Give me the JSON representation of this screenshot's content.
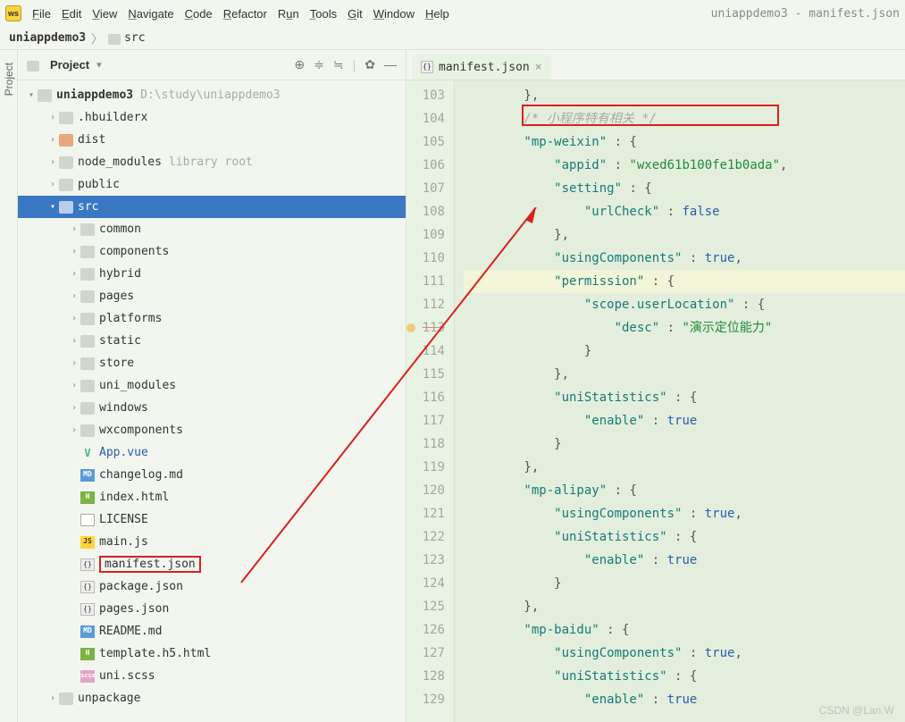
{
  "titlebar": {
    "right": "uniappdemo3 - manifest.json"
  },
  "menu": [
    "File",
    "Edit",
    "View",
    "Navigate",
    "Code",
    "Refactor",
    "Run",
    "Tools",
    "Git",
    "Window",
    "Help"
  ],
  "breadcrumb": {
    "root": "uniappdemo3",
    "path": "src"
  },
  "sidetab": "Project",
  "panel": {
    "title": "Project"
  },
  "tree": {
    "root_name": "uniappdemo3",
    "root_path": "D:\\study\\uniappdemo3",
    "items": [
      {
        "name": ".hbuilderx",
        "type": "folder"
      },
      {
        "name": "dist",
        "type": "folder-dist"
      },
      {
        "name": "node_modules",
        "type": "folder",
        "hint": "library root"
      },
      {
        "name": "public",
        "type": "folder"
      },
      {
        "name": "src",
        "type": "folder",
        "selected": true,
        "expanded": true
      },
      {
        "name": "common",
        "type": "folder",
        "depth": 2,
        "exp": true
      },
      {
        "name": "components",
        "type": "folder",
        "depth": 2,
        "exp": true
      },
      {
        "name": "hybrid",
        "type": "folder",
        "depth": 2,
        "exp": true
      },
      {
        "name": "pages",
        "type": "folder",
        "depth": 2,
        "exp": true
      },
      {
        "name": "platforms",
        "type": "folder",
        "depth": 2,
        "exp": true
      },
      {
        "name": "static",
        "type": "folder",
        "depth": 2,
        "exp": true
      },
      {
        "name": "store",
        "type": "folder",
        "depth": 2,
        "exp": true
      },
      {
        "name": "uni_modules",
        "type": "folder",
        "depth": 2,
        "exp": true
      },
      {
        "name": "windows",
        "type": "folder",
        "depth": 2,
        "exp": true
      },
      {
        "name": "wxcomponents",
        "type": "folder",
        "depth": 2,
        "exp": true
      },
      {
        "name": "App.vue",
        "type": "vue",
        "depth": 2,
        "blue": true
      },
      {
        "name": "changelog.md",
        "type": "md",
        "depth": 2
      },
      {
        "name": "index.html",
        "type": "html",
        "depth": 2
      },
      {
        "name": "LICENSE",
        "type": "file",
        "depth": 2
      },
      {
        "name": "main.js",
        "type": "js",
        "depth": 2
      },
      {
        "name": "manifest.json",
        "type": "json",
        "depth": 2,
        "boxed": true
      },
      {
        "name": "package.json",
        "type": "json",
        "depth": 2
      },
      {
        "name": "pages.json",
        "type": "json",
        "depth": 2
      },
      {
        "name": "README.md",
        "type": "md",
        "depth": 2
      },
      {
        "name": "template.h5.html",
        "type": "html",
        "depth": 2
      },
      {
        "name": "uni.scss",
        "type": "scss",
        "depth": 2
      },
      {
        "name": "unpackage",
        "type": "folder"
      }
    ]
  },
  "tab_file": "manifest.json",
  "gutter": [
    103,
    104,
    105,
    106,
    107,
    108,
    109,
    110,
    111,
    112,
    113,
    114,
    115,
    116,
    117,
    118,
    119,
    120,
    121,
    122,
    123,
    124,
    125,
    126,
    127,
    128,
    129
  ],
  "code": {
    "l103": "        },",
    "l104_c": "        /* 小程序特有相关 */",
    "l105_a": "        \"mp-weixin\"",
    "l105_b": " : {",
    "l106_a": "            \"appid\"",
    "l106_b": " : ",
    "l106_c": "\"wxed61b100fe1b0ada\"",
    "l106_d": ",",
    "l107_a": "            \"setting\"",
    "l107_b": " : {",
    "l108_a": "                \"urlCheck\"",
    "l108_b": " : ",
    "l108_c": "false",
    "l109": "            },",
    "l110_a": "            \"usingComponents\"",
    "l110_b": " : ",
    "l110_c": "true",
    "l110_d": ",",
    "l111_a": "            \"permission\"",
    "l111_b": " : {",
    "l112_a": "                \"scope.userLocation\"",
    "l112_b": " : {",
    "l113_a": "                    \"desc\"",
    "l113_b": " : ",
    "l113_c": "\"演示定位能力\"",
    "l114": "                }",
    "l115": "            },",
    "l116_a": "            \"uniStatistics\"",
    "l116_b": " : {",
    "l117_a": "                \"enable\"",
    "l117_b": " : ",
    "l117_c": "true",
    "l118": "            }",
    "l119": "        },",
    "l120_a": "        \"mp-alipay\"",
    "l120_b": " : {",
    "l121_a": "            \"usingComponents\"",
    "l121_b": " : ",
    "l121_c": "true",
    "l121_d": ",",
    "l122_a": "            \"uniStatistics\"",
    "l122_b": " : {",
    "l123_a": "                \"enable\"",
    "l123_b": " : ",
    "l123_c": "true",
    "l124": "            }",
    "l125": "        },",
    "l126_a": "        \"mp-baidu\"",
    "l126_b": " : {",
    "l127_a": "            \"usingComponents\"",
    "l127_b": " : ",
    "l127_c": "true",
    "l127_d": ",",
    "l128_a": "            \"uniStatistics\"",
    "l128_b": " : {",
    "l129_a": "                \"enable\"",
    "l129_b": " : ",
    "l129_c": "true"
  },
  "watermark": "CSDN @Lan.W"
}
